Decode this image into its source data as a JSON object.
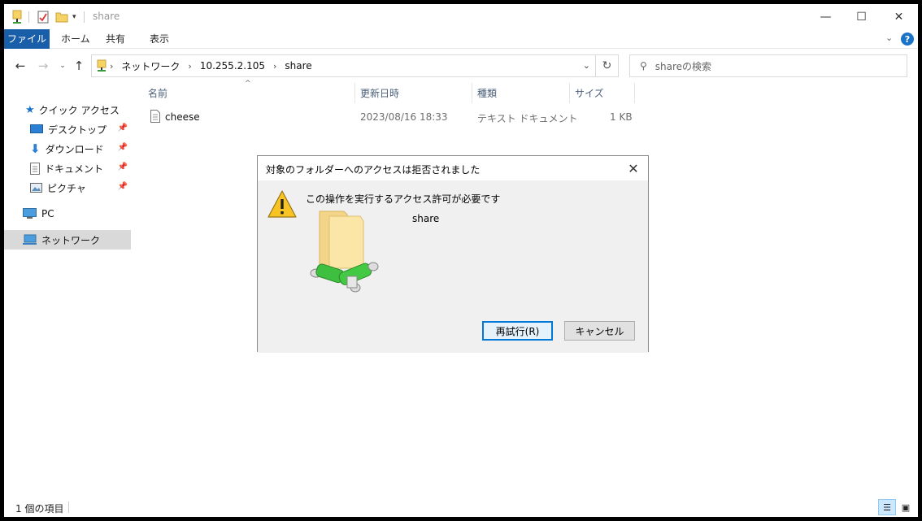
{
  "window": {
    "title": "share",
    "controls": {
      "minimize": "—",
      "maximize": "☐",
      "close": "✕"
    }
  },
  "ribbon": {
    "tabs": [
      "ファイル",
      "ホーム",
      "共有",
      "表示"
    ]
  },
  "address": {
    "crumbs": [
      "ネットワーク",
      "10.255.2.105",
      "share"
    ],
    "search_placeholder": "shareの検索"
  },
  "sidebar": {
    "quick_access": "クイック アクセス",
    "items": [
      {
        "label": "デスクトップ",
        "icon": "desktop-icon"
      },
      {
        "label": "ダウンロード",
        "icon": "download-icon"
      },
      {
        "label": "ドキュメント",
        "icon": "document-icon"
      },
      {
        "label": "ピクチャ",
        "icon": "picture-icon"
      }
    ],
    "pc": "PC",
    "network": "ネットワーク"
  },
  "filelist": {
    "columns": [
      "名前",
      "更新日時",
      "種類",
      "サイズ"
    ],
    "rows": [
      {
        "name": "cheese",
        "modified": "2023/08/16 18:33",
        "type": "テキスト ドキュメント",
        "size": "1 KB"
      }
    ]
  },
  "status": {
    "count": "1 個の項目"
  },
  "dialog": {
    "title": "対象のフォルダーへのアクセスは拒否されました",
    "message": "この操作を実行するアクセス許可が必要です",
    "folder_name": "share",
    "retry": "再試行(R)",
    "cancel": "キャンセル"
  },
  "colors": {
    "accent": "#195ea8",
    "selected": "#d9d9d9",
    "focus": "#0078d7"
  }
}
